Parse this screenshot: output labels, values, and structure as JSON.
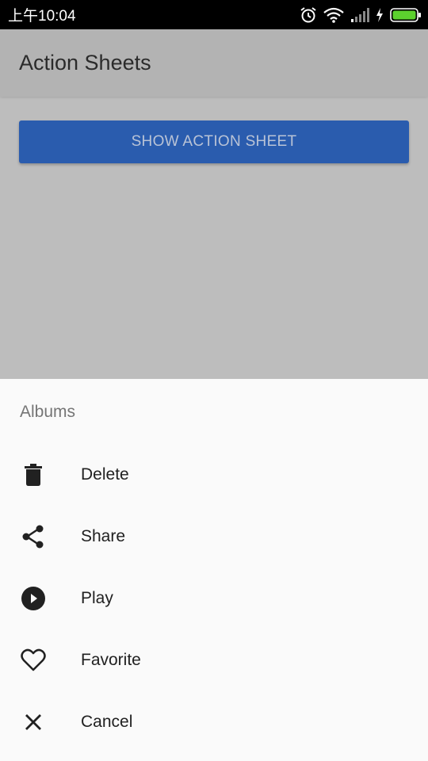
{
  "status_bar": {
    "time": "上午10:04",
    "icons": [
      "alarm-icon",
      "wifi-icon",
      "signal-icon",
      "charging-icon",
      "battery-icon"
    ],
    "battery_color": "#5cd12e"
  },
  "app_bar": {
    "title": "Action Sheets",
    "background": "#b3b3b3"
  },
  "main": {
    "show_button_label": "SHOW ACTION SHEET",
    "button_color": "#2a5cae"
  },
  "action_sheet": {
    "title": "Albums",
    "items": [
      {
        "label": "Delete",
        "icon": "delete-icon"
      },
      {
        "label": "Share",
        "icon": "share-icon"
      },
      {
        "label": "Play",
        "icon": "play-icon"
      },
      {
        "label": "Favorite",
        "icon": "favorite-icon"
      },
      {
        "label": "Cancel",
        "icon": "close-icon"
      }
    ]
  }
}
